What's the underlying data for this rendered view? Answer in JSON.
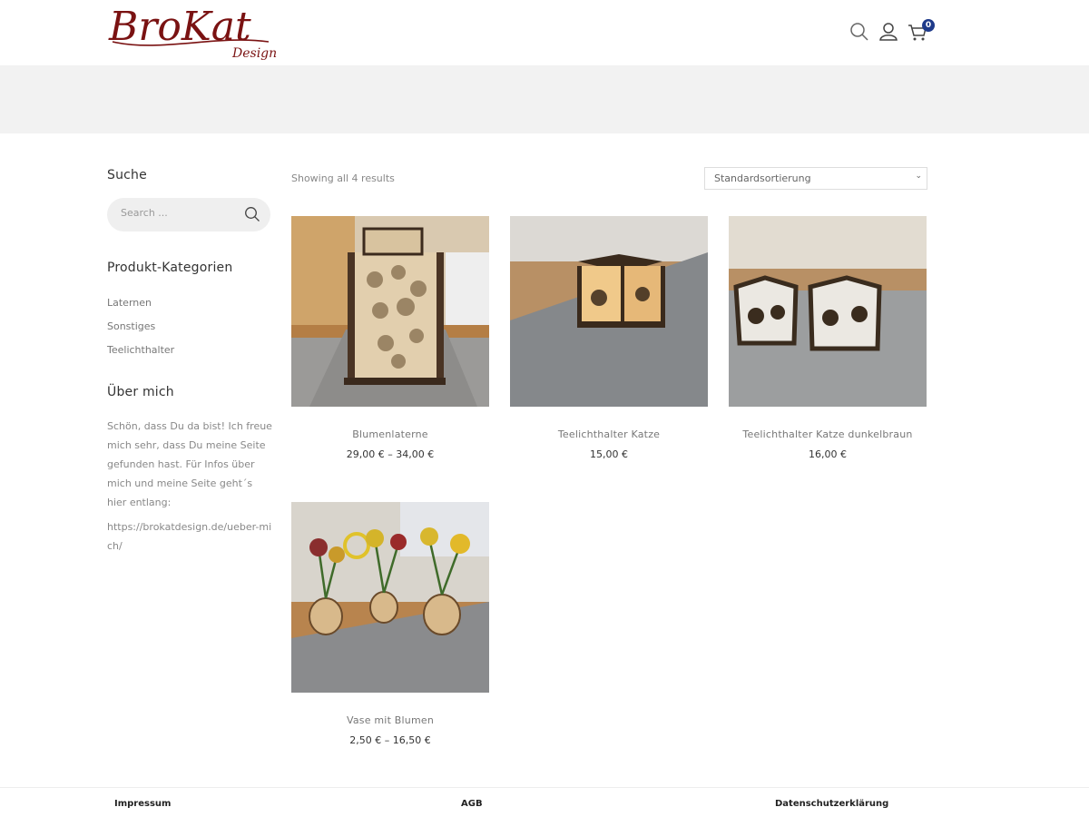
{
  "brand": {
    "name": "BroKat",
    "sub": "Design",
    "color": "#7a1212"
  },
  "header": {
    "cart_count": "0",
    "icons": [
      "search-icon",
      "user-icon",
      "cart-icon"
    ]
  },
  "sidebar": {
    "search_title": "Suche",
    "search_placeholder": "Search ...",
    "categories_title": "Produkt-Kategorien",
    "categories": [
      "Laternen",
      "Sonstiges",
      "Teelichthalter"
    ],
    "about_title": "Über mich",
    "about_text": "Schön, dass Du da bist! Ich freue mich sehr, dass Du meine Seite gefunden hast. Für Infos über mich und meine Seite geht´s hier entlang:",
    "about_link": "https://brokatdesign.de/ueber-mich/"
  },
  "shop": {
    "result_count": "Showing all 4 results",
    "sort_selected": "Standardsortierung",
    "products": [
      {
        "name": "Blumenlaterne",
        "price": "29,00 € – 34,00 €"
      },
      {
        "name": "Teelichthalter Katze",
        "price": "15,00 €"
      },
      {
        "name": "Teelichthalter Katze dunkelbraun",
        "price": "16,00 €"
      },
      {
        "name": "Vase mit Blumen",
        "price": "2,50 € – 16,50 €"
      }
    ]
  },
  "footer": {
    "links": [
      "Impressum",
      "AGB",
      "Datenschutzerklärung"
    ]
  }
}
